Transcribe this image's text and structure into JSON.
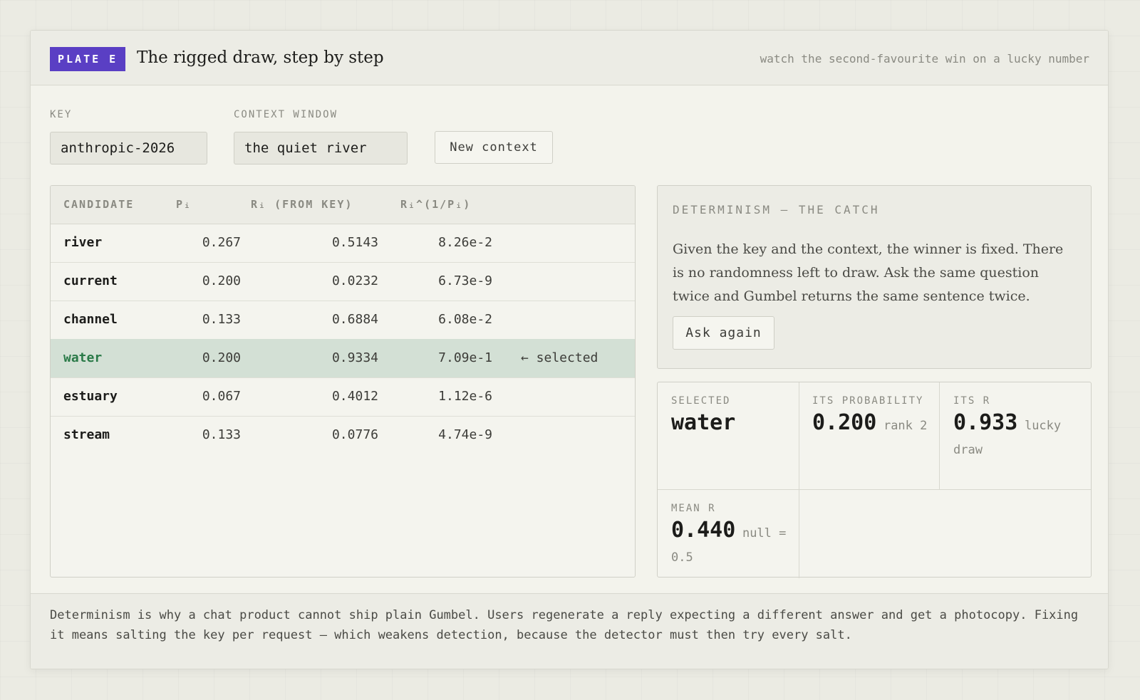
{
  "header": {
    "plate": "PLATE E",
    "title": "The rigged draw, step by step",
    "tagline": "watch the second-favourite win on a lucky number"
  },
  "controls": {
    "key_label": "KEY",
    "key_value": "anthropic-2026",
    "context_label": "CONTEXT WINDOW",
    "context_value": "the quiet river",
    "new_context_button": "New context"
  },
  "table": {
    "columns": [
      "CANDIDATE",
      "Pᵢ",
      "Rᵢ (FROM KEY)",
      "Rᵢ^(1/Pᵢ)"
    ],
    "rows": [
      {
        "candidate": "river",
        "p": "0.267",
        "r": "0.5143",
        "x": "8.26e-2",
        "marker": ""
      },
      {
        "candidate": "current",
        "p": "0.200",
        "r": "0.0232",
        "x": "6.73e-9",
        "marker": ""
      },
      {
        "candidate": "channel",
        "p": "0.133",
        "r": "0.6884",
        "x": "6.08e-2",
        "marker": ""
      },
      {
        "candidate": "water",
        "p": "0.200",
        "r": "0.9334",
        "x": "7.09e-1",
        "marker": "← selected"
      },
      {
        "candidate": "estuary",
        "p": "0.067",
        "r": "0.4012",
        "x": "1.12e-6",
        "marker": ""
      },
      {
        "candidate": "stream",
        "p": "0.133",
        "r": "0.0776",
        "x": "4.74e-9",
        "marker": ""
      }
    ]
  },
  "determinism": {
    "title": "DETERMINISM — THE CATCH",
    "body": "Given the key and the context, the winner is fixed. There is no randomness left to draw. Ask the same question twice and Gumbel returns the same sentence twice.",
    "ask_button": "Ask again"
  },
  "stats": {
    "selected_label": "SELECTED",
    "selected_value": "water",
    "prob_label": "ITS PROBABILITY",
    "prob_value": "0.200",
    "prob_note": "rank 2",
    "r_label": "ITS R",
    "r_value": "0.933",
    "r_note": "lucky draw",
    "mean_label": "MEAN R",
    "mean_value": "0.440",
    "mean_note": "null = 0.5"
  },
  "footer": {
    "text": "Determinism is why a chat product cannot ship plain Gumbel. Users regenerate a reply expecting a different answer and get a photocopy. Fixing it means salting the key per request — which weakens detection, because the detector must then try every salt."
  },
  "colors": {
    "accent": "#5a3fc4",
    "selected_row_bg": "#d3e0d5",
    "selected_text": "#2a7a48"
  }
}
